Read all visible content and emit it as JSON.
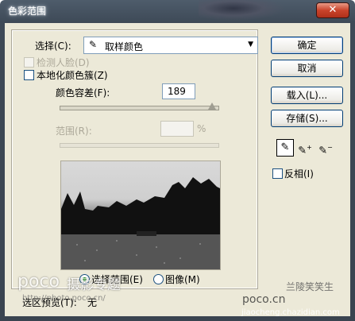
{
  "window": {
    "title": "色彩范围",
    "close_label": "✕"
  },
  "select": {
    "label": "选择(C):",
    "value": "取样颜色",
    "icon": "eyedropper-icon"
  },
  "detect_faces": {
    "label": "检测人脸(D)",
    "checked": false,
    "enabled": false
  },
  "localized": {
    "label": "本地化颜色簇(Z)",
    "checked": false
  },
  "fuzziness": {
    "label": "颜色容差(F):",
    "value": "189",
    "slider_fraction": 0.95
  },
  "range": {
    "label": "范围(R):",
    "value": "",
    "unit": "%"
  },
  "preview_modes": {
    "selection": "选择范围(E)",
    "image": "图像(M)",
    "selected": "selection"
  },
  "selection_preview": {
    "label": "选区预览(T):",
    "value": "无"
  },
  "buttons": {
    "ok": "确定",
    "cancel": "取消",
    "load": "载入(L)...",
    "save": "存储(S)..."
  },
  "eyedroppers": [
    "eyedropper-icon",
    "eyedropper-plus-icon",
    "eyedropper-minus-icon"
  ],
  "invert": {
    "label": "反相(I)",
    "checked": false
  },
  "watermarks": {
    "poco_logo": "poco",
    "poco_title": "摄影专题",
    "poco_url": "http://photo.poco.cn/",
    "poco_url2": "poco.cn",
    "author": "兰陵笑笑生",
    "site": "jiaocheng.chazidian.com"
  }
}
